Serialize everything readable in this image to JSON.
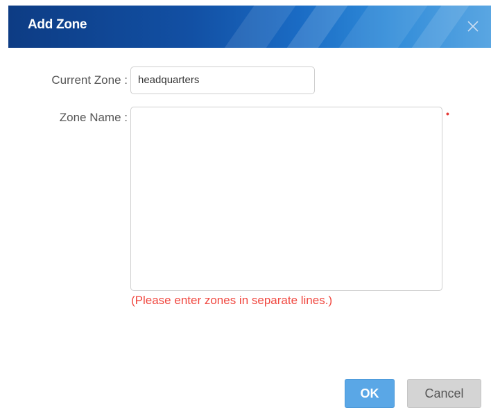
{
  "dialog": {
    "title": "Add Zone",
    "close_icon": "close-icon"
  },
  "form": {
    "current_zone_label": "Current Zone :",
    "current_zone_value": "headquarters",
    "zone_name_label": "Zone Name :",
    "zone_name_value": "",
    "required_mark": "•",
    "hint": "(Please enter zones in separate lines.)"
  },
  "buttons": {
    "ok_label": "OK",
    "cancel_label": "Cancel"
  },
  "colors": {
    "titlebar": "#1250a4",
    "hint": "#f0473f",
    "ok_button": "#5aa7e6",
    "cancel_button": "#d4d4d4"
  }
}
